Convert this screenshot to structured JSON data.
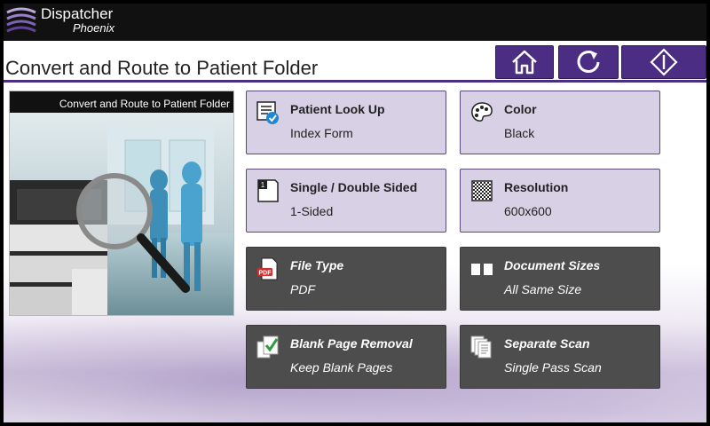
{
  "app": {
    "name": "Dispatcher",
    "subname": "Phoenix"
  },
  "page": {
    "title": "Convert and Route to Patient Folder"
  },
  "toolbar": {
    "home_icon": "home-icon",
    "reset_icon": "refresh-icon",
    "start_icon": "start-diamond-icon"
  },
  "preview": {
    "caption": "Convert and Route to Patient Folder"
  },
  "colors": {
    "accent": "#4b2e83",
    "tile_light": "#d8d1e6",
    "tile_dark": "#4d4d4d"
  },
  "settings": [
    {
      "label": "Patient Look Up",
      "value": "Index Form",
      "icon": "index-form-icon",
      "enabled": true
    },
    {
      "label": "Color",
      "value": "Black",
      "icon": "palette-icon",
      "enabled": true
    },
    {
      "label": "Single / Double Sided",
      "value": "1-Sided",
      "icon": "single-sided-page-icon",
      "enabled": true
    },
    {
      "label": "Resolution",
      "value": "600x600",
      "icon": "resolution-grid-icon",
      "enabled": true
    },
    {
      "label": "File Type",
      "value": "PDF",
      "icon": "pdf-file-icon",
      "enabled": false
    },
    {
      "label": "Document Sizes",
      "value": "All Same Size",
      "icon": "document-sizes-icon",
      "enabled": false
    },
    {
      "label": "Blank Page Removal",
      "value": "Keep Blank Pages",
      "icon": "blank-page-check-icon",
      "enabled": false
    },
    {
      "label": "Separate Scan",
      "value": "Single Pass Scan",
      "icon": "separate-scan-pages-icon",
      "enabled": false
    }
  ]
}
